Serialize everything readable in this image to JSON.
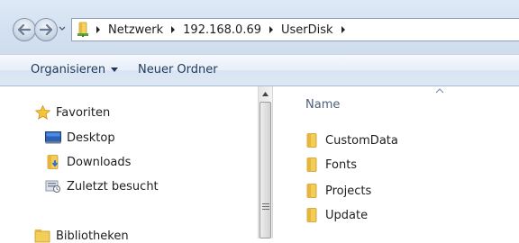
{
  "address_bar": {
    "breadcrumbs": [
      "Netzwerk",
      "192.168.0.69",
      "UserDisk"
    ]
  },
  "toolbar": {
    "organize_label": "Organisieren",
    "new_folder_label": "Neuer Ordner"
  },
  "nav_pane": {
    "favorites_label": "Favoriten",
    "items": [
      {
        "label": "Desktop",
        "icon": "desktop-icon"
      },
      {
        "label": "Downloads",
        "icon": "downloads-folder-icon"
      },
      {
        "label": "Zuletzt besucht",
        "icon": "recent-places-icon"
      }
    ],
    "libraries_label": "Bibliotheken"
  },
  "content": {
    "column_header": "Name",
    "files": [
      {
        "name": "CustomData",
        "icon": "folder-icon"
      },
      {
        "name": "Fonts",
        "icon": "folder-icon"
      },
      {
        "name": "Projects",
        "icon": "folder-icon"
      },
      {
        "name": "Update",
        "icon": "folder-icon"
      }
    ]
  }
}
